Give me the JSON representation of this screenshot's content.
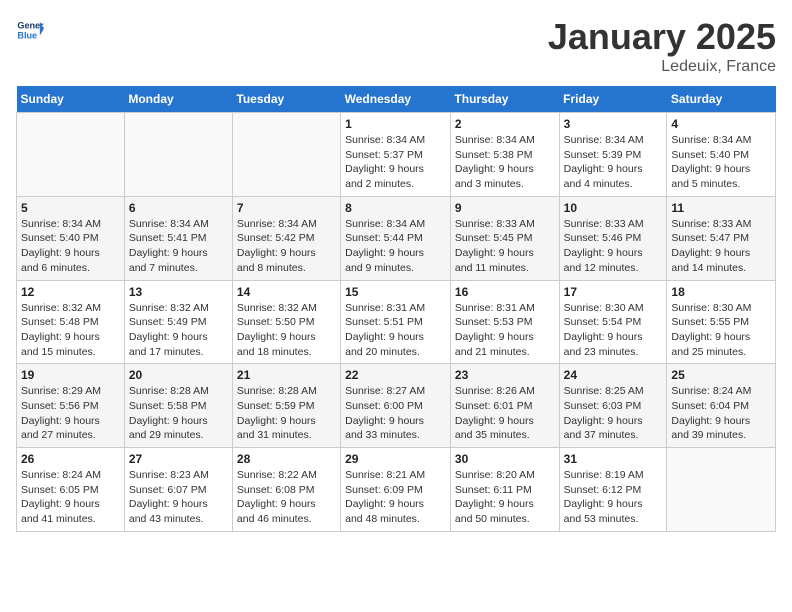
{
  "header": {
    "logo_general": "General",
    "logo_blue": "Blue",
    "month_title": "January 2025",
    "location": "Ledeuix, France"
  },
  "days_of_week": [
    "Sunday",
    "Monday",
    "Tuesday",
    "Wednesday",
    "Thursday",
    "Friday",
    "Saturday"
  ],
  "weeks": [
    [
      {
        "day": "",
        "info": ""
      },
      {
        "day": "",
        "info": ""
      },
      {
        "day": "",
        "info": ""
      },
      {
        "day": "1",
        "info": "Sunrise: 8:34 AM\nSunset: 5:37 PM\nDaylight: 9 hours\nand 2 minutes."
      },
      {
        "day": "2",
        "info": "Sunrise: 8:34 AM\nSunset: 5:38 PM\nDaylight: 9 hours\nand 3 minutes."
      },
      {
        "day": "3",
        "info": "Sunrise: 8:34 AM\nSunset: 5:39 PM\nDaylight: 9 hours\nand 4 minutes."
      },
      {
        "day": "4",
        "info": "Sunrise: 8:34 AM\nSunset: 5:40 PM\nDaylight: 9 hours\nand 5 minutes."
      }
    ],
    [
      {
        "day": "5",
        "info": "Sunrise: 8:34 AM\nSunset: 5:40 PM\nDaylight: 9 hours\nand 6 minutes."
      },
      {
        "day": "6",
        "info": "Sunrise: 8:34 AM\nSunset: 5:41 PM\nDaylight: 9 hours\nand 7 minutes."
      },
      {
        "day": "7",
        "info": "Sunrise: 8:34 AM\nSunset: 5:42 PM\nDaylight: 9 hours\nand 8 minutes."
      },
      {
        "day": "8",
        "info": "Sunrise: 8:34 AM\nSunset: 5:44 PM\nDaylight: 9 hours\nand 9 minutes."
      },
      {
        "day": "9",
        "info": "Sunrise: 8:33 AM\nSunset: 5:45 PM\nDaylight: 9 hours\nand 11 minutes."
      },
      {
        "day": "10",
        "info": "Sunrise: 8:33 AM\nSunset: 5:46 PM\nDaylight: 9 hours\nand 12 minutes."
      },
      {
        "day": "11",
        "info": "Sunrise: 8:33 AM\nSunset: 5:47 PM\nDaylight: 9 hours\nand 14 minutes."
      }
    ],
    [
      {
        "day": "12",
        "info": "Sunrise: 8:32 AM\nSunset: 5:48 PM\nDaylight: 9 hours\nand 15 minutes."
      },
      {
        "day": "13",
        "info": "Sunrise: 8:32 AM\nSunset: 5:49 PM\nDaylight: 9 hours\nand 17 minutes."
      },
      {
        "day": "14",
        "info": "Sunrise: 8:32 AM\nSunset: 5:50 PM\nDaylight: 9 hours\nand 18 minutes."
      },
      {
        "day": "15",
        "info": "Sunrise: 8:31 AM\nSunset: 5:51 PM\nDaylight: 9 hours\nand 20 minutes."
      },
      {
        "day": "16",
        "info": "Sunrise: 8:31 AM\nSunset: 5:53 PM\nDaylight: 9 hours\nand 21 minutes."
      },
      {
        "day": "17",
        "info": "Sunrise: 8:30 AM\nSunset: 5:54 PM\nDaylight: 9 hours\nand 23 minutes."
      },
      {
        "day": "18",
        "info": "Sunrise: 8:30 AM\nSunset: 5:55 PM\nDaylight: 9 hours\nand 25 minutes."
      }
    ],
    [
      {
        "day": "19",
        "info": "Sunrise: 8:29 AM\nSunset: 5:56 PM\nDaylight: 9 hours\nand 27 minutes."
      },
      {
        "day": "20",
        "info": "Sunrise: 8:28 AM\nSunset: 5:58 PM\nDaylight: 9 hours\nand 29 minutes."
      },
      {
        "day": "21",
        "info": "Sunrise: 8:28 AM\nSunset: 5:59 PM\nDaylight: 9 hours\nand 31 minutes."
      },
      {
        "day": "22",
        "info": "Sunrise: 8:27 AM\nSunset: 6:00 PM\nDaylight: 9 hours\nand 33 minutes."
      },
      {
        "day": "23",
        "info": "Sunrise: 8:26 AM\nSunset: 6:01 PM\nDaylight: 9 hours\nand 35 minutes."
      },
      {
        "day": "24",
        "info": "Sunrise: 8:25 AM\nSunset: 6:03 PM\nDaylight: 9 hours\nand 37 minutes."
      },
      {
        "day": "25",
        "info": "Sunrise: 8:24 AM\nSunset: 6:04 PM\nDaylight: 9 hours\nand 39 minutes."
      }
    ],
    [
      {
        "day": "26",
        "info": "Sunrise: 8:24 AM\nSunset: 6:05 PM\nDaylight: 9 hours\nand 41 minutes."
      },
      {
        "day": "27",
        "info": "Sunrise: 8:23 AM\nSunset: 6:07 PM\nDaylight: 9 hours\nand 43 minutes."
      },
      {
        "day": "28",
        "info": "Sunrise: 8:22 AM\nSunset: 6:08 PM\nDaylight: 9 hours\nand 46 minutes."
      },
      {
        "day": "29",
        "info": "Sunrise: 8:21 AM\nSunset: 6:09 PM\nDaylight: 9 hours\nand 48 minutes."
      },
      {
        "day": "30",
        "info": "Sunrise: 8:20 AM\nSunset: 6:11 PM\nDaylight: 9 hours\nand 50 minutes."
      },
      {
        "day": "31",
        "info": "Sunrise: 8:19 AM\nSunset: 6:12 PM\nDaylight: 9 hours\nand 53 minutes."
      },
      {
        "day": "",
        "info": ""
      }
    ]
  ]
}
